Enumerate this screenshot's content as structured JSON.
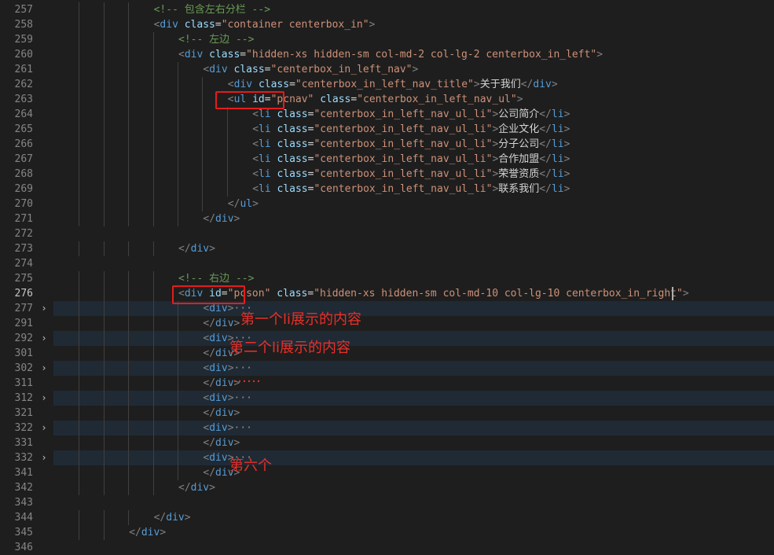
{
  "lines": [
    {
      "n": "257",
      "ind": 4,
      "t": [
        [
          "cm",
          "<!-- 包含左右分栏 -->"
        ]
      ]
    },
    {
      "n": "258",
      "ind": 4,
      "t": [
        [
          "tg",
          "<"
        ],
        [
          "tn",
          "div"
        ],
        [
          "tx",
          " "
        ],
        [
          "an",
          "class"
        ],
        [
          "tx",
          "="
        ],
        [
          "av",
          "\"container centerbox_in\""
        ],
        [
          "tg",
          ">"
        ]
      ]
    },
    {
      "n": "259",
      "ind": 5,
      "t": [
        [
          "cm",
          "<!-- 左边 -->"
        ]
      ]
    },
    {
      "n": "260",
      "ind": 5,
      "t": [
        [
          "tg",
          "<"
        ],
        [
          "tn",
          "div"
        ],
        [
          "tx",
          " "
        ],
        [
          "an",
          "class"
        ],
        [
          "tx",
          "="
        ],
        [
          "av",
          "\"hidden-xs hidden-sm col-md-2 col-lg-2 centerbox_in_left\""
        ],
        [
          "tg",
          ">"
        ]
      ]
    },
    {
      "n": "261",
      "ind": 6,
      "t": [
        [
          "tg",
          "<"
        ],
        [
          "tn",
          "div"
        ],
        [
          "tx",
          " "
        ],
        [
          "an",
          "class"
        ],
        [
          "tx",
          "="
        ],
        [
          "av",
          "\"centerbox_in_left_nav\""
        ],
        [
          "tg",
          ">"
        ]
      ]
    },
    {
      "n": "262",
      "ind": 7,
      "t": [
        [
          "tg",
          "<"
        ],
        [
          "tn",
          "div"
        ],
        [
          "tx",
          " "
        ],
        [
          "an",
          "class"
        ],
        [
          "tx",
          "="
        ],
        [
          "av",
          "\"centerbox_in_left_nav_title\""
        ],
        [
          "tg",
          ">"
        ],
        [
          "tx",
          "关于我们"
        ],
        [
          "tg",
          "</"
        ],
        [
          "tn",
          "div"
        ],
        [
          "tg",
          ">"
        ]
      ]
    },
    {
      "n": "263",
      "ind": 7,
      "t": [
        [
          "tg",
          "<"
        ],
        [
          "tn",
          "ul"
        ],
        [
          "tx",
          " "
        ],
        [
          "an",
          "id"
        ],
        [
          "tx",
          "="
        ],
        [
          "av",
          "\"pcnav\""
        ],
        [
          "tx",
          " "
        ],
        [
          "an",
          "class"
        ],
        [
          "tx",
          "="
        ],
        [
          "av",
          "\"centerbox_in_left_nav_ul\""
        ],
        [
          "tg",
          ">"
        ]
      ]
    },
    {
      "n": "264",
      "ind": 8,
      "t": [
        [
          "tg",
          "<"
        ],
        [
          "tn",
          "li"
        ],
        [
          "tx",
          " "
        ],
        [
          "an",
          "class"
        ],
        [
          "tx",
          "="
        ],
        [
          "av",
          "\"centerbox_in_left_nav_ul_li\""
        ],
        [
          "tg",
          ">"
        ],
        [
          "tx",
          "公司简介"
        ],
        [
          "tg",
          "</"
        ],
        [
          "tn",
          "li"
        ],
        [
          "tg",
          ">"
        ]
      ]
    },
    {
      "n": "265",
      "ind": 8,
      "t": [
        [
          "tg",
          "<"
        ],
        [
          "tn",
          "li"
        ],
        [
          "tx",
          " "
        ],
        [
          "an",
          "class"
        ],
        [
          "tx",
          "="
        ],
        [
          "av",
          "\"centerbox_in_left_nav_ul_li\""
        ],
        [
          "tg",
          ">"
        ],
        [
          "tx",
          "企业文化"
        ],
        [
          "tg",
          "</"
        ],
        [
          "tn",
          "li"
        ],
        [
          "tg",
          ">"
        ]
      ]
    },
    {
      "n": "266",
      "ind": 8,
      "t": [
        [
          "tg",
          "<"
        ],
        [
          "tn",
          "li"
        ],
        [
          "tx",
          " "
        ],
        [
          "an",
          "class"
        ],
        [
          "tx",
          "="
        ],
        [
          "av",
          "\"centerbox_in_left_nav_ul_li\""
        ],
        [
          "tg",
          ">"
        ],
        [
          "tx",
          "分子公司"
        ],
        [
          "tg",
          "</"
        ],
        [
          "tn",
          "li"
        ],
        [
          "tg",
          ">"
        ]
      ]
    },
    {
      "n": "267",
      "ind": 8,
      "t": [
        [
          "tg",
          "<"
        ],
        [
          "tn",
          "li"
        ],
        [
          "tx",
          " "
        ],
        [
          "an",
          "class"
        ],
        [
          "tx",
          "="
        ],
        [
          "av",
          "\"centerbox_in_left_nav_ul_li\""
        ],
        [
          "tg",
          ">"
        ],
        [
          "tx",
          "合作加盟"
        ],
        [
          "tg",
          "</"
        ],
        [
          "tn",
          "li"
        ],
        [
          "tg",
          ">"
        ]
      ]
    },
    {
      "n": "268",
      "ind": 8,
      "t": [
        [
          "tg",
          "<"
        ],
        [
          "tn",
          "li"
        ],
        [
          "tx",
          " "
        ],
        [
          "an",
          "class"
        ],
        [
          "tx",
          "="
        ],
        [
          "av",
          "\"centerbox_in_left_nav_ul_li\""
        ],
        [
          "tg",
          ">"
        ],
        [
          "tx",
          "荣誉资质"
        ],
        [
          "tg",
          "</"
        ],
        [
          "tn",
          "li"
        ],
        [
          "tg",
          ">"
        ]
      ]
    },
    {
      "n": "269",
      "ind": 8,
      "t": [
        [
          "tg",
          "<"
        ],
        [
          "tn",
          "li"
        ],
        [
          "tx",
          " "
        ],
        [
          "an",
          "class"
        ],
        [
          "tx",
          "="
        ],
        [
          "av",
          "\"centerbox_in_left_nav_ul_li\""
        ],
        [
          "tg",
          ">"
        ],
        [
          "tx",
          "联系我们"
        ],
        [
          "tg",
          "</"
        ],
        [
          "tn",
          "li"
        ],
        [
          "tg",
          ">"
        ]
      ]
    },
    {
      "n": "270",
      "ind": 7,
      "t": [
        [
          "tg",
          "</"
        ],
        [
          "tn",
          "ul"
        ],
        [
          "tg",
          ">"
        ]
      ]
    },
    {
      "n": "271",
      "ind": 6,
      "t": [
        [
          "tg",
          "</"
        ],
        [
          "tn",
          "div"
        ],
        [
          "tg",
          ">"
        ]
      ]
    },
    {
      "n": "272",
      "ind": 0,
      "t": []
    },
    {
      "n": "273",
      "ind": 5,
      "t": [
        [
          "tg",
          "</"
        ],
        [
          "tn",
          "div"
        ],
        [
          "tg",
          ">"
        ]
      ]
    },
    {
      "n": "274",
      "ind": 0,
      "t": []
    },
    {
      "n": "275",
      "ind": 5,
      "t": [
        [
          "cm",
          "<!-- 右边 -->"
        ]
      ]
    },
    {
      "n": "276",
      "ind": 5,
      "current": true,
      "t": [
        [
          "tg",
          "<"
        ],
        [
          "tn",
          "div"
        ],
        [
          "tx",
          " "
        ],
        [
          "an",
          "id"
        ],
        [
          "tx",
          "="
        ],
        [
          "av",
          "\"pcson\""
        ],
        [
          "tx",
          " "
        ],
        [
          "an",
          "class"
        ],
        [
          "tx",
          "="
        ],
        [
          "av",
          "\"hidden-xs hidden-sm col-md-10 col-lg-10 centerbox_in_right\""
        ],
        [
          "tg",
          ">"
        ]
      ]
    },
    {
      "n": "277",
      "ind": 6,
      "fold": true,
      "t": [
        [
          "tg",
          "<"
        ],
        [
          "tn",
          "div"
        ],
        [
          "tg",
          ">"
        ],
        [
          "el",
          "···"
        ]
      ]
    },
    {
      "n": "291",
      "ind": 6,
      "t": [
        [
          "tg",
          "</"
        ],
        [
          "tn",
          "div"
        ],
        [
          "tg",
          ">"
        ]
      ]
    },
    {
      "n": "292",
      "ind": 6,
      "fold": true,
      "t": [
        [
          "tg",
          "<"
        ],
        [
          "tn",
          "div"
        ],
        [
          "tg",
          ">"
        ],
        [
          "el",
          "···"
        ]
      ]
    },
    {
      "n": "301",
      "ind": 6,
      "t": [
        [
          "tg",
          "</"
        ],
        [
          "tn",
          "div"
        ],
        [
          "tg",
          ">"
        ]
      ]
    },
    {
      "n": "302",
      "ind": 6,
      "fold": true,
      "t": [
        [
          "tg",
          "<"
        ],
        [
          "tn",
          "div"
        ],
        [
          "tg",
          ">"
        ],
        [
          "el",
          "···"
        ]
      ]
    },
    {
      "n": "311",
      "ind": 6,
      "t": [
        [
          "tg",
          "</"
        ],
        [
          "tn",
          "div"
        ],
        [
          "tg",
          ">"
        ]
      ]
    },
    {
      "n": "312",
      "ind": 6,
      "fold": true,
      "t": [
        [
          "tg",
          "<"
        ],
        [
          "tn",
          "div"
        ],
        [
          "tg",
          ">"
        ],
        [
          "el",
          "···"
        ]
      ]
    },
    {
      "n": "321",
      "ind": 6,
      "t": [
        [
          "tg",
          "</"
        ],
        [
          "tn",
          "div"
        ],
        [
          "tg",
          ">"
        ]
      ]
    },
    {
      "n": "322",
      "ind": 6,
      "fold": true,
      "t": [
        [
          "tg",
          "<"
        ],
        [
          "tn",
          "div"
        ],
        [
          "tg",
          ">"
        ],
        [
          "el",
          "···"
        ]
      ]
    },
    {
      "n": "331",
      "ind": 6,
      "t": [
        [
          "tg",
          "</"
        ],
        [
          "tn",
          "div"
        ],
        [
          "tg",
          ">"
        ]
      ]
    },
    {
      "n": "332",
      "ind": 6,
      "fold": true,
      "t": [
        [
          "tg",
          "<"
        ],
        [
          "tn",
          "div"
        ],
        [
          "tg",
          ">"
        ],
        [
          "el",
          "···"
        ]
      ]
    },
    {
      "n": "341",
      "ind": 6,
      "t": [
        [
          "tg",
          "</"
        ],
        [
          "tn",
          "div"
        ],
        [
          "tg",
          ">"
        ]
      ]
    },
    {
      "n": "342",
      "ind": 5,
      "t": [
        [
          "tg",
          "</"
        ],
        [
          "tn",
          "div"
        ],
        [
          "tg",
          ">"
        ]
      ]
    },
    {
      "n": "343",
      "ind": 0,
      "t": []
    },
    {
      "n": "344",
      "ind": 4,
      "t": [
        [
          "tg",
          "</"
        ],
        [
          "tn",
          "div"
        ],
        [
          "tg",
          ">"
        ]
      ]
    },
    {
      "n": "345",
      "ind": 3,
      "t": [
        [
          "tg",
          "</"
        ],
        [
          "tn",
          "div"
        ],
        [
          "tg",
          ">"
        ]
      ]
    },
    {
      "n": "346",
      "ind": 0,
      "t": []
    }
  ],
  "fold_icon": "chevron-right-icon",
  "annotations": {
    "note1": "第一个li展示的内容",
    "note2": "第二个li展示的内容",
    "note3": "……",
    "note4": "第六个"
  },
  "colors": {
    "background": "#1e1e1e",
    "folded_line": "#1f2a35",
    "highlight_box": "#e51c1c",
    "annotation": "#e8302a"
  }
}
